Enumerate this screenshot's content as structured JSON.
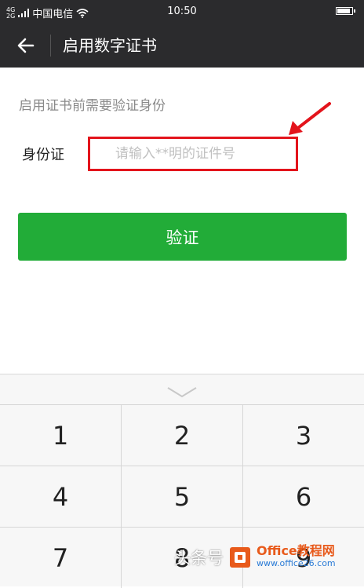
{
  "status_bar": {
    "signal_tag": "4G\n2G",
    "carrier": "中国电信",
    "time": "10:50",
    "battery_level": 0.9
  },
  "nav": {
    "back_icon": "arrow-left-icon",
    "title": "启用数字证书"
  },
  "form": {
    "hint": "启用证书前需要验证身份",
    "id_label": "身份证",
    "id_placeholder": "请输入**明的证件号",
    "id_value": "",
    "highlight_color": "#e3141c"
  },
  "verify_button": {
    "label": "验证",
    "color": "#22ac38"
  },
  "keyboard": {
    "collapse_icon": "chevron-down-icon",
    "rows": [
      [
        "1",
        "2",
        "3"
      ],
      [
        "4",
        "5",
        "6"
      ],
      [
        "7",
        "8",
        "9"
      ]
    ]
  },
  "watermark": {
    "text": "头条号",
    "brand_main": "Office教程网",
    "brand_url": "www.office26.com"
  }
}
